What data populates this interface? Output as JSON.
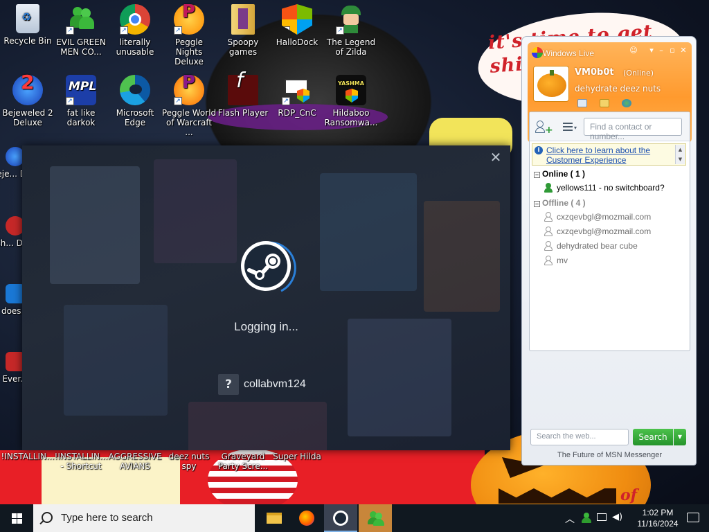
{
  "wallpaper": {
    "speech_text": "it's time to get shit and ... or t...",
    "bottom_text": "of"
  },
  "desktop": {
    "icons": [
      {
        "label": "Recycle Bin",
        "icon": "recycle-bin-icon"
      },
      {
        "label": "EVIL GREEN MEN CO...",
        "icon": "msn-buddies-icon"
      },
      {
        "label": "literally unusable",
        "icon": "chrome-icon"
      },
      {
        "label": "Peggle Nights Deluxe",
        "icon": "peggle-icon"
      },
      {
        "label": "Spoopy games",
        "icon": "folder-icon"
      },
      {
        "label": "HalloDock",
        "icon": "windows-logo-icon"
      },
      {
        "label": "The Legend of Zilda",
        "icon": "zelda-character-icon"
      },
      {
        "label": "Bejeweled 2 Deluxe",
        "icon": "bejeweled-icon"
      },
      {
        "label": "fat like darkok",
        "icon": "mpl-icon"
      },
      {
        "label": "Microsoft Edge",
        "icon": "edge-icon"
      },
      {
        "label": "Peggle World of Warcraft ...",
        "icon": "peggle-wow-icon"
      },
      {
        "label": "Flash Player",
        "icon": "flash-icon"
      },
      {
        "label": "RDP_CnC",
        "icon": "rdp-icon"
      },
      {
        "label": "Hildaboo Ransomwa...",
        "icon": "yashma-icon"
      },
      {
        "label": "Beje... De...",
        "icon": "bejeweled-icon"
      },
      {
        "label": "Ch... De...",
        "icon": "app-icon"
      },
      {
        "label": "does...",
        "icon": "app-icon"
      },
      {
        "label": "Ever...",
        "icon": "app-icon"
      },
      {
        "label": "!INSTALLIN...",
        "icon": "installer-icon"
      },
      {
        "label": "!INSTALLIN... - Shortcut",
        "icon": "installer-icon"
      },
      {
        "label": "AGGRESSIVE AVIANS",
        "icon": "app-icon"
      },
      {
        "label": "deez nuts spy",
        "icon": "app-icon"
      },
      {
        "label": "Graveyard Party Scre...",
        "icon": "app-icon"
      },
      {
        "label": "Super Hilda",
        "icon": "app-icon"
      }
    ]
  },
  "steam": {
    "status": "Logging in...",
    "help_glyph": "?",
    "account": "collabvm124",
    "close_glyph": "✕"
  },
  "msn": {
    "title": "Windows Live",
    "username": "VM0b0t",
    "user_status": "(Online)",
    "personal_message": "dehydrate deez nuts",
    "find_placeholder": "Find a contact or number...",
    "info_link": "Click here to learn about the Customer Experience",
    "groups": {
      "online": {
        "label": "Online ( 1 )"
      },
      "offline": {
        "label": "Offline ( 4 )"
      }
    },
    "contacts_online": [
      {
        "name": "yellows111 - no switchboard?"
      }
    ],
    "contacts_offline": [
      {
        "name": "cxzqevbgl@mozmail.com"
      },
      {
        "name": "cxzqevbgl@mozmail.com"
      },
      {
        "name": "dehydrated bear cube"
      },
      {
        "name": "mv"
      }
    ],
    "web_search_placeholder": "Search the web...",
    "search_button": "Search",
    "footer": "The Future of MSN Messenger",
    "colors": {
      "header": "#ff9a2e",
      "search_button": "#25932b"
    }
  },
  "taskbar": {
    "search_placeholder": "Type here to search",
    "apps": [
      {
        "name": "file-explorer-icon",
        "active": false
      },
      {
        "name": "firefox-icon",
        "active": false
      },
      {
        "name": "steam-icon",
        "active": true
      },
      {
        "name": "msn-messenger-icon",
        "active": true
      }
    ],
    "time": "1:02 PM",
    "date": "11/16/2024"
  }
}
